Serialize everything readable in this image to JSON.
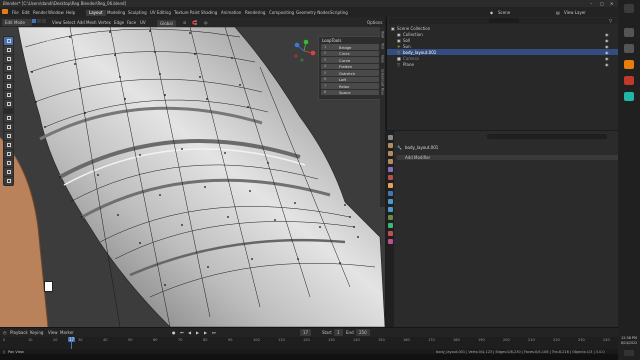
{
  "titlebar": {
    "title": "Blender* [C:\\Users\\dandi\\Desktop\\Reg Blender\\Reg_06.blend]"
  },
  "menus": [
    "File",
    "Edit",
    "Render",
    "Window",
    "Help"
  ],
  "workspaces": [
    "Layout",
    "Modeling",
    "Sculpting",
    "UV Editing",
    "Texture Paint",
    "Shading",
    "Animation",
    "Rendering",
    "Compositing",
    "Geometry Nodes",
    "Scripting"
  ],
  "scene": {
    "label": "Scene",
    "view_layer": "View Layer"
  },
  "viewport_header": {
    "mode": "Edit Mode",
    "menus": [
      "View",
      "Select",
      "Add",
      "Mesh",
      "Vertex",
      "Edge",
      "Face",
      "UV"
    ],
    "orientation": "Global",
    "options": "Options"
  },
  "viewport": {
    "info_line1": "User Perspective",
    "info_line2": "(17) body_layout.001"
  },
  "looptools": {
    "title": "LoopTools",
    "items": [
      {
        "key": "1",
        "label": "Bridge"
      },
      {
        "key": "2",
        "label": "Circle"
      },
      {
        "key": "3",
        "label": "Curve"
      },
      {
        "key": "4",
        "label": "Flatten"
      },
      {
        "key": "5",
        "label": "Gstretch"
      },
      {
        "key": "6",
        "label": "Loft"
      },
      {
        "key": "7",
        "label": "Relax"
      },
      {
        "key": "8",
        "label": "Space"
      }
    ]
  },
  "sidebar_tabs": [
    "Item",
    "Tool",
    "View",
    "Screencast Keys"
  ],
  "outliner": {
    "rows": [
      {
        "label": "Scene Collection",
        "indent": 0
      },
      {
        "label": "Collection",
        "indent": 1
      },
      {
        "label": "Soll",
        "indent": 1
      },
      {
        "label": "Sun",
        "indent": 1
      },
      {
        "label": "body_layout.001",
        "indent": 1,
        "selected": true
      },
      {
        "label": "Camera",
        "indent": 1
      },
      {
        "label": "Plane",
        "indent": 1
      }
    ]
  },
  "properties": {
    "object_name": "body_layout.001",
    "add_modifier": "Add Modifier",
    "search_placeholder": ""
  },
  "timeline": {
    "menus": [
      "Playback",
      "Keying",
      "View",
      "Marker"
    ],
    "current_frame": "17",
    "start_label": "Start",
    "start": "1",
    "end_label": "End",
    "end": "250",
    "ruler": [
      "0",
      "10",
      "20",
      "30",
      "40",
      "50",
      "60",
      "70",
      "80",
      "90",
      "100",
      "110",
      "120",
      "130",
      "140",
      "150",
      "160",
      "170",
      "180",
      "190",
      "200",
      "210",
      "220",
      "230",
      "240"
    ]
  },
  "statusbar": {
    "left": "Pan View",
    "right": "body_layout.001 | Verts:0/4,123 | Edges:0/8,230 | Faces:0/4,108 | Tris:8,216 | Objects:1/3 | 3.0.0"
  },
  "taskbar": {
    "time": "12:38 PM",
    "date": "8/24/2022"
  },
  "colors": {
    "accent": "#4772b3",
    "mesh_light": "#dcdcdc",
    "mesh_dark": "#6f6f6f",
    "skin": "#b9825a",
    "selected_row": "#334d80",
    "playhead": "#4772b3",
    "taskbar_icon_orange": "#e87d0d",
    "taskbar_icon_teal": "#1fb8a8"
  }
}
